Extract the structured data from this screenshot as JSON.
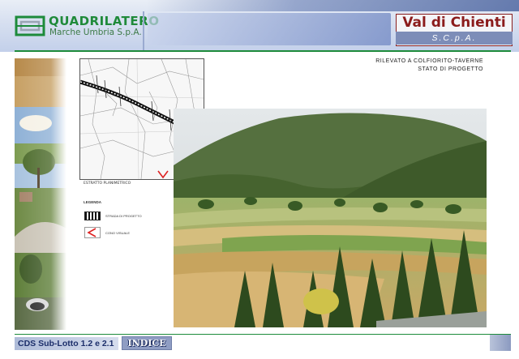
{
  "header": {
    "logo_title": "QUADRILATERO",
    "logo_subtitle": "Marche Umbria S.p.A.",
    "brand_title": "Val di Chienti",
    "brand_subtitle": "S.C.p.A."
  },
  "map": {
    "caption": "ESTRATTO PLANIMETRICO",
    "legend_title": "LEGENDA",
    "legend_items": [
      {
        "label": "STRADA DI PROGETTO"
      },
      {
        "label": "CONO VISUALE"
      }
    ]
  },
  "title": {
    "line1": "RILEVATO A COLFIORITO-TAVERNE",
    "line2": "STATO DI PROGETTO"
  },
  "footer": {
    "section_label": "CDS Sub-Lotto 1.2 e 2.1",
    "index_button": "INDICE"
  },
  "colors": {
    "brand_green": "#1d8b3b",
    "brand_red": "#8b1c1c",
    "header_blue": "#7d8db8"
  }
}
